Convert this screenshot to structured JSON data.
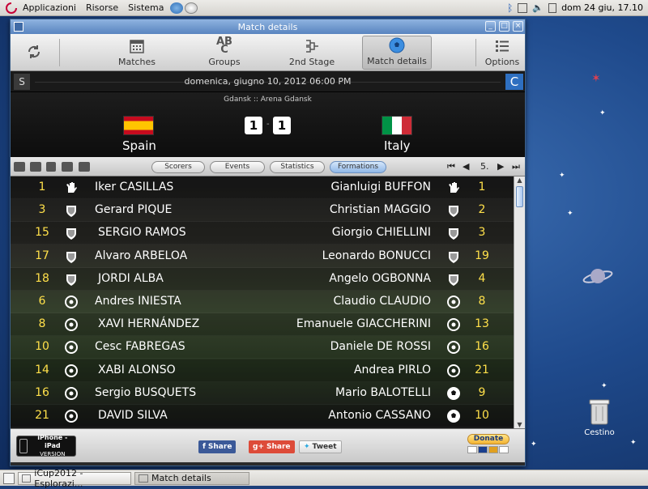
{
  "topbar": {
    "menus": [
      "Applicazioni",
      "Risorse",
      "Sistema"
    ],
    "clock": "dom 24 giu, 17.10"
  },
  "taskbar": {
    "tasks": [
      "iCup2012 - Esplorazi...",
      "Match details"
    ]
  },
  "desktop": {
    "trash_label": "Cestino"
  },
  "window": {
    "title": "Match details"
  },
  "toolbar": {
    "buttons": [
      "Matches",
      "Groups",
      "2nd Stage",
      "Match details",
      "Options"
    ],
    "active": "Match details"
  },
  "match": {
    "left_box": "S",
    "right_box": "C",
    "date": "domenica, giugno 10, 2012 06:00 PM",
    "venue": "Gdansk :: Arena Gdansk",
    "home": "Spain",
    "away": "Italy",
    "home_score": "1",
    "away_score": "1",
    "separator": "-"
  },
  "tabs": [
    "Scorers",
    "Events",
    "Statistics",
    "Formations"
  ],
  "active_tab": "Formations",
  "pager": {
    "page": "5."
  },
  "lineup": [
    {
      "hn": "1",
      "hname": "Iker CASILLAS",
      "hicon": "glove",
      "aname": "Gianluigi BUFFON",
      "aicon": "glove",
      "an": "1"
    },
    {
      "hn": "3",
      "hname": "Gerard PIQUE",
      "hicon": "shield",
      "aname": "Christian MAGGIO",
      "aicon": "shield",
      "an": "2"
    },
    {
      "hn": "15",
      "hname": "SERGIO RAMOS",
      "hicon": "shield",
      "aname": "Giorgio CHIELLINI",
      "aicon": "shield",
      "an": "3"
    },
    {
      "hn": "17",
      "hname": "Alvaro ARBELOA",
      "hicon": "shield",
      "aname": "Leonardo BONUCCI",
      "aicon": "shield",
      "an": "19"
    },
    {
      "hn": "18",
      "hname": "JORDI ALBA",
      "hicon": "shield",
      "aname": "Angelo OGBONNA",
      "aicon": "shield",
      "an": "4"
    },
    {
      "hn": "6",
      "hname": "Andres INIESTA",
      "hicon": "target",
      "aname": "Claudio CLAUDIO",
      "aicon": "target",
      "an": "8"
    },
    {
      "hn": "8",
      "hname": "XAVI HERNÁNDEZ",
      "hicon": "target",
      "aname": "Emanuele GIACCHERINI",
      "aicon": "target",
      "an": "13"
    },
    {
      "hn": "10",
      "hname": "Cesc FABREGAS",
      "hicon": "target",
      "aname": "Daniele DE ROSSI",
      "aicon": "target",
      "an": "16"
    },
    {
      "hn": "14",
      "hname": "XABI ALONSO",
      "hicon": "target",
      "aname": "Andrea PIRLO",
      "aicon": "target",
      "an": "21"
    },
    {
      "hn": "16",
      "hname": "Sergio BUSQUETS",
      "hicon": "target",
      "aname": "Mario BALOTELLI",
      "aicon": "ball",
      "an": "9"
    },
    {
      "hn": "21",
      "hname": "DAVID SILVA",
      "hicon": "target",
      "aname": "Antonio CASSANO",
      "aicon": "ball",
      "an": "10"
    }
  ],
  "footer": {
    "ipad_title": "iPhone - iPad",
    "ipad_sub": "VERSION",
    "fb": "Share",
    "gplus": "Share",
    "tw": "Tweet",
    "donate": "Donate"
  }
}
